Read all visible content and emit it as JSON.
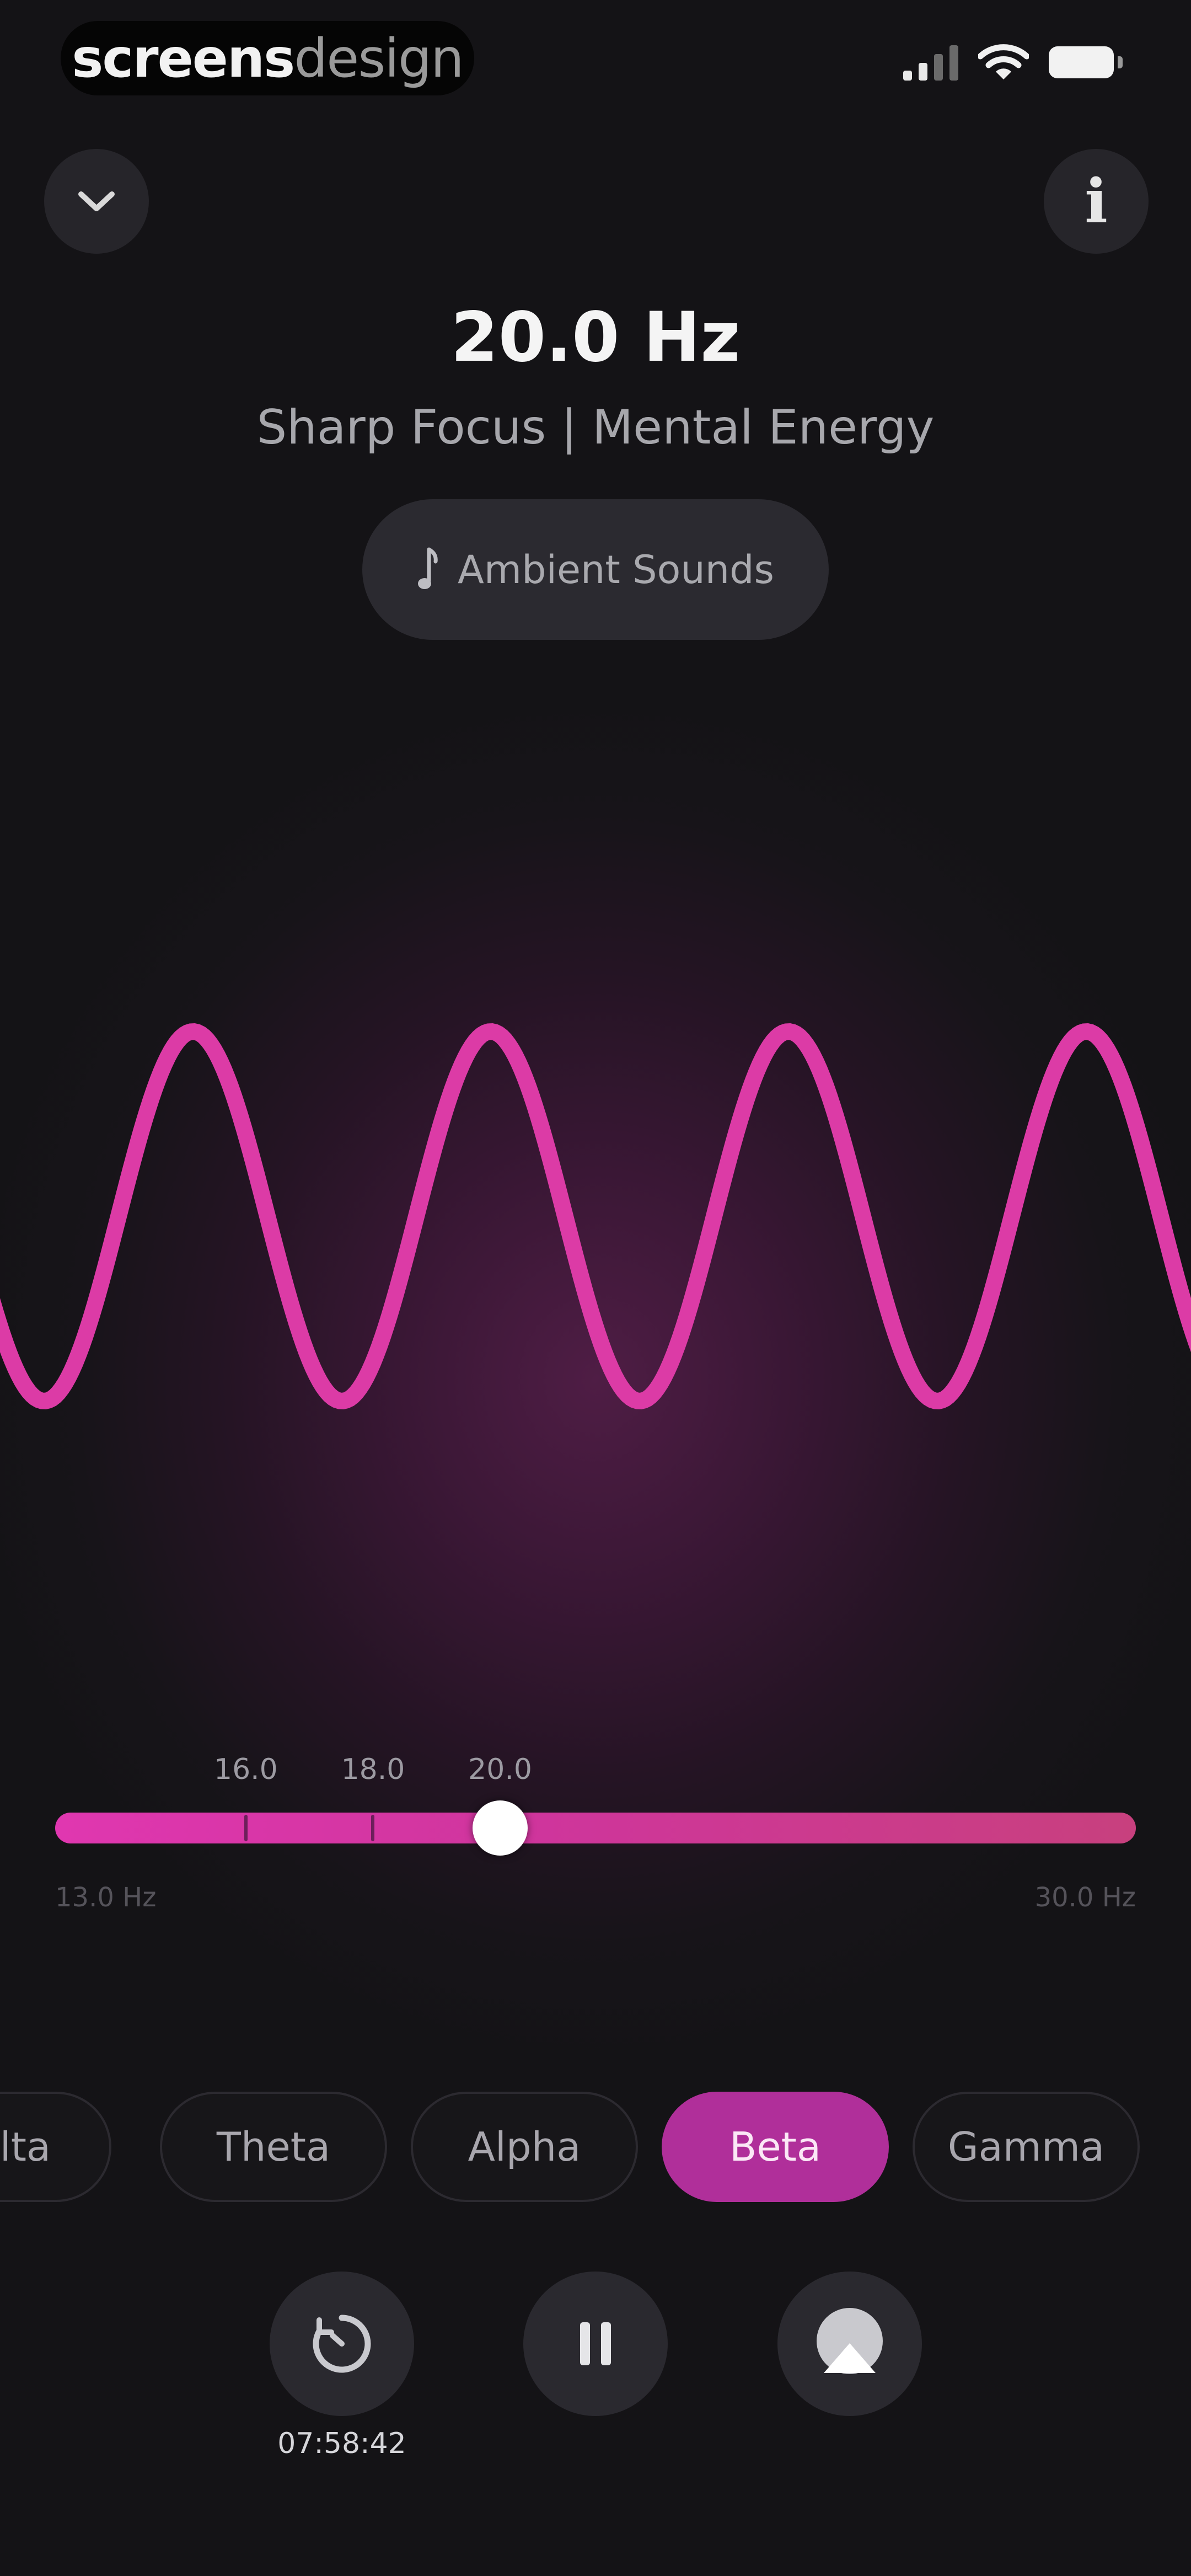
{
  "status_bar": {
    "brand_part1": "screens",
    "brand_part2": "design"
  },
  "header": {
    "frequency": "20.0 Hz",
    "subtitle": "Sharp Focus | Mental Energy",
    "ambient_label": "Ambient Sounds"
  },
  "slider": {
    "ticks": [
      {
        "label": "16.0",
        "value": 16.0
      },
      {
        "label": "18.0",
        "value": 18.0
      },
      {
        "label": "20.0",
        "value": 20.0
      }
    ],
    "min_value": 13.0,
    "max_value": 30.0,
    "current_value": 20.0,
    "min_label": "13.0 Hz",
    "max_label": "30.0 Hz"
  },
  "bands": [
    {
      "label": "Delta",
      "active": false
    },
    {
      "label": "Theta",
      "active": false
    },
    {
      "label": "Alpha",
      "active": false
    },
    {
      "label": "Beta",
      "active": true
    },
    {
      "label": "Gamma",
      "active": false
    }
  ],
  "controls": {
    "timer_label": "07:58:42"
  },
  "colors": {
    "accent": "#e037b0",
    "wave": "#dc3ba6",
    "active_chip": "#b02f9a",
    "background": "#141316"
  }
}
